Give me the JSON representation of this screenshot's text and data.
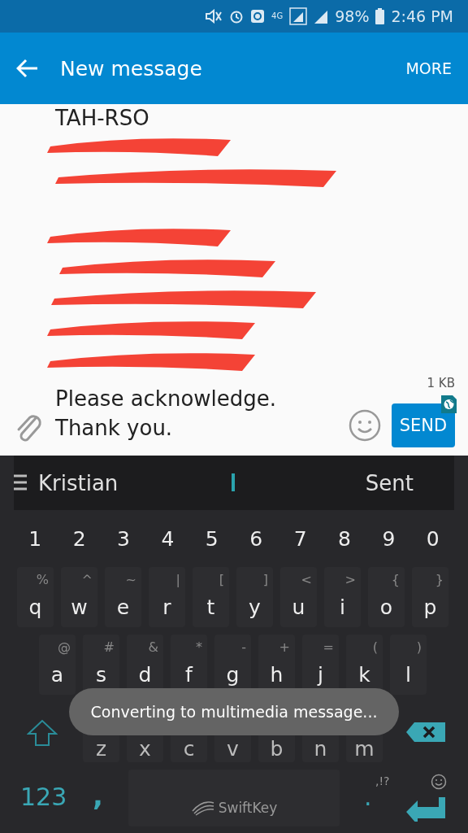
{
  "status_bar": {
    "battery": "98%",
    "time": "2:46 PM",
    "network": "4G"
  },
  "app_bar": {
    "title": "New message",
    "more": "MORE"
  },
  "message": {
    "lines": [
      {
        "kind": "text",
        "text": "TAH-RSO"
      },
      {
        "kind": "redacted"
      },
      {
        "kind": "redacted"
      },
      {
        "kind": "blank"
      },
      {
        "kind": "redacted"
      },
      {
        "kind": "redacted"
      },
      {
        "kind": "redacted"
      },
      {
        "kind": "redacted"
      },
      {
        "kind": "redacted"
      },
      {
        "kind": "blank"
      },
      {
        "kind": "text",
        "text": "Please acknowledge."
      },
      {
        "kind": "text",
        "text": "Thank you."
      }
    ],
    "size": "1 KB",
    "send": "SEND"
  },
  "suggestions": [
    "Kristian",
    "Sent"
  ],
  "keyboard": {
    "numbers": [
      "1",
      "2",
      "3",
      "4",
      "5",
      "6",
      "7",
      "8",
      "9",
      "0"
    ],
    "rows": [
      [
        {
          "key": "q",
          "alt": "%"
        },
        {
          "key": "w",
          "alt": "^"
        },
        {
          "key": "e",
          "alt": "~"
        },
        {
          "key": "r",
          "alt": "|"
        },
        {
          "key": "t",
          "alt": "["
        },
        {
          "key": "y",
          "alt": "]"
        },
        {
          "key": "u",
          "alt": "<"
        },
        {
          "key": "i",
          "alt": ">"
        },
        {
          "key": "o",
          "alt": "{"
        },
        {
          "key": "p",
          "alt": "}"
        }
      ],
      [
        {
          "key": "a",
          "alt": "@"
        },
        {
          "key": "s",
          "alt": "#"
        },
        {
          "key": "d",
          "alt": "&"
        },
        {
          "key": "f",
          "alt": "*"
        },
        {
          "key": "g",
          "alt": "-"
        },
        {
          "key": "h",
          "alt": "+"
        },
        {
          "key": "j",
          "alt": "="
        },
        {
          "key": "k",
          "alt": "("
        },
        {
          "key": "l",
          "alt": ")"
        }
      ],
      [
        {
          "key": "z"
        },
        {
          "key": "x"
        },
        {
          "key": "c"
        },
        {
          "key": "v"
        },
        {
          "key": "b"
        },
        {
          "key": "n"
        },
        {
          "key": "m"
        }
      ]
    ],
    "mode": "123",
    "comma": ",",
    "space": "SwiftKey",
    "period": ".",
    "punct": ",!?"
  },
  "toast": "Converting to multimedia message..."
}
